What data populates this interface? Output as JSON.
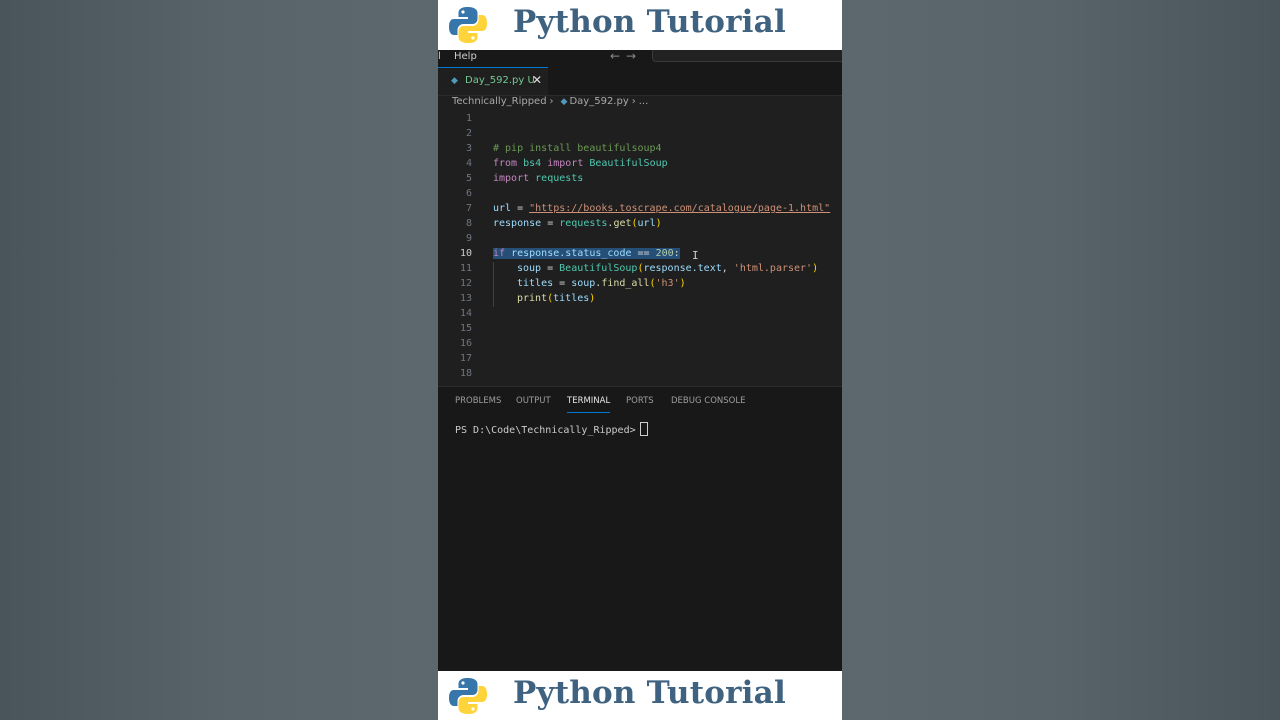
{
  "banner": {
    "title": "Python Tutorial"
  },
  "menubar": {
    "help_label": "Help",
    "edge_label": "l",
    "nav_arrows": "←→"
  },
  "tab": {
    "filename": "Day_592.py",
    "status": "U",
    "close": "✕"
  },
  "breadcrumb": {
    "folder": "Technically_Ripped",
    "file": "Day_592.py",
    "more": "..."
  },
  "editor": {
    "line_numbers": [
      "1",
      "2",
      "3",
      "4",
      "5",
      "6",
      "7",
      "8",
      "9",
      "10",
      "11",
      "12",
      "13",
      "14",
      "15",
      "16",
      "17",
      "18"
    ],
    "active_line": "10",
    "comment": "# pip install beautifulsoup4",
    "kw_from": "from",
    "mod_bs4": "bs4",
    "kw_import": "import",
    "cls_bs": "BeautifulSoup",
    "mod_requests": "requests",
    "var_url": "url",
    "op_eq": " = ",
    "url_string": "\"https://books.toscrape.com/catalogue/page-1.html\"",
    "var_response": "response",
    "fn_get": "get",
    "arg_url": "url",
    "kw_if": "if",
    "attr_status": "response.status_code",
    "op_cmp": " == ",
    "num_200": "200",
    "colon": ":",
    "var_soup": "soup",
    "attr_text": "response.text",
    "str_parser": "'html.parser'",
    "var_titles": "titles",
    "obj_soup": "soup",
    "fn_find_all": "find_all",
    "str_h3": "'h3'",
    "fn_print": "print",
    "arg_titles": "titles",
    "dot": ".",
    "comma": ", ",
    "lparen": "(",
    "rparen": ")"
  },
  "panel": {
    "tabs": [
      "PROBLEMS",
      "OUTPUT",
      "TERMINAL",
      "PORTS",
      "DEBUG CONSOLE"
    ],
    "active_tab": "TERMINAL",
    "prompt": "PS D:\\Code\\Technically_Ripped>"
  },
  "colors": {
    "accent": "#0078d4",
    "banner_text": "#3f6280",
    "python_blue": "#3776ab",
    "python_yellow": "#ffd43b"
  }
}
